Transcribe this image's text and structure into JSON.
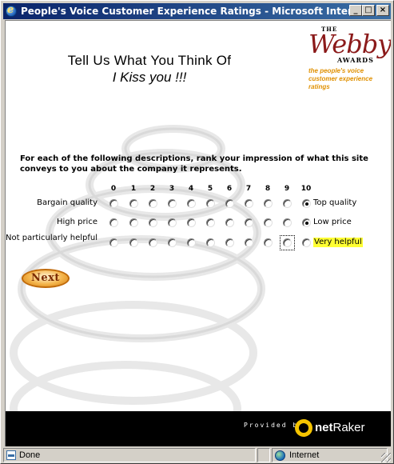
{
  "window": {
    "title": "People's Voice Customer Experience Ratings - Microsoft Internet Explorer",
    "buttons": {
      "minimize": "_",
      "maximize": "□",
      "close": "×"
    }
  },
  "page": {
    "heading_line1": "Tell Us What You Think Of",
    "heading_line2": "I Kiss you !!!",
    "webby": {
      "the": "THE",
      "logo": "Webby",
      "awards": "AWARDS",
      "tagline": "the people's voice customer experience ratings"
    },
    "instructions": "For each of the following descriptions, rank your impression of what this site conveys to you about the company it represents.",
    "scale": [
      "0",
      "1",
      "2",
      "3",
      "4",
      "5",
      "6",
      "7",
      "8",
      "9",
      "10"
    ],
    "rows": [
      {
        "left": "Bargain quality",
        "right": "Top quality",
        "selected": 10,
        "highlight": false
      },
      {
        "left": "High price",
        "right": "Low price",
        "selected": 10,
        "highlight": false
      },
      {
        "left": "Not particularly helpful",
        "right": "Very helpful",
        "selected": null,
        "focused": 9,
        "highlight": true
      }
    ],
    "next_button": "Next",
    "footer": {
      "provided_by": "Provided by",
      "brand_net": "net",
      "brand_raker": "Raker"
    }
  },
  "statusbar": {
    "status": "Done",
    "zone": "Internet"
  },
  "colors": {
    "title_bar": "#0a246a",
    "webby_red": "#8b1a1a",
    "tag_orange": "#e09000",
    "highlight": "#ffff33",
    "next_orange": "#f4b44a"
  }
}
